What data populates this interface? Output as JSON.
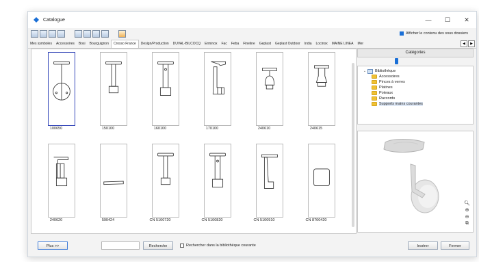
{
  "window": {
    "title": "Catalogue",
    "controls": {
      "minimize": "—",
      "maximize": "☐",
      "close": "✕"
    }
  },
  "toolbar": {
    "show_subfolders_label": "Afficher le contenu des sous dossiers",
    "show_subfolders_checked": true
  },
  "tabs": [
    {
      "label": "Mes symboles"
    },
    {
      "label": "Accessoires"
    },
    {
      "label": "Bosi"
    },
    {
      "label": "Bourguignon"
    },
    {
      "label": "Crosso France",
      "active": true
    },
    {
      "label": "Design/Production"
    },
    {
      "label": "DUVAL-BILCOCQ"
    },
    {
      "label": "Erminox"
    },
    {
      "label": "Fac"
    },
    {
      "label": "Feba"
    },
    {
      "label": "Fineline"
    },
    {
      "label": "Geplast"
    },
    {
      "label": "Geplast Outdoor"
    },
    {
      "label": "India"
    },
    {
      "label": "Locinox"
    },
    {
      "label": "MAINE LINEA"
    },
    {
      "label": "Mer"
    }
  ],
  "catalogue_items": [
    {
      "label": "100650",
      "shape": "round-plate",
      "selected": true
    },
    {
      "label": "150100",
      "shape": "post-long"
    },
    {
      "label": "160100",
      "shape": "post-dot"
    },
    {
      "label": "170100",
      "shape": "angled"
    },
    {
      "label": "240610",
      "shape": "bell"
    },
    {
      "label": "240615",
      "shape": "bell-small"
    },
    {
      "label": "240620",
      "shape": "bracket"
    },
    {
      "label": "590424",
      "shape": "flat"
    },
    {
      "label": "CN 5100720",
      "shape": "post-long"
    },
    {
      "label": "CN 5100820",
      "shape": "post-dot"
    },
    {
      "label": "CN 5100910",
      "shape": "angled-long"
    },
    {
      "label": "CN 8700420",
      "shape": "square"
    }
  ],
  "categories": {
    "header": "Catégories",
    "tree": [
      {
        "label": "Bibliothèque",
        "level": 0,
        "type": "root"
      },
      {
        "label": "Accessoires",
        "level": 1
      },
      {
        "label": "Pinces à verres",
        "level": 1
      },
      {
        "label": "Platines",
        "level": 1
      },
      {
        "label": "Poteaux",
        "level": 1
      },
      {
        "label": "Raccords",
        "level": 1
      },
      {
        "label": "Supports mains courantes",
        "level": 1,
        "selected": true
      }
    ]
  },
  "preview": {
    "zoom_icons": [
      "search-icon",
      "zoom-in-icon",
      "zoom-out-icon",
      "zoom-fit-icon"
    ]
  },
  "bottom": {
    "more_label": "Plus >>",
    "search_value": "",
    "search_label": "Recherche",
    "search_current_label": "Rechercher dans la bibliothèque courante",
    "search_current_checked": false,
    "insert_label": "Insérer",
    "close_label": "Fermer"
  },
  "colors": {
    "accent": "#1a6fd6",
    "selection": "#3446b8",
    "folder": "#f1c232"
  }
}
